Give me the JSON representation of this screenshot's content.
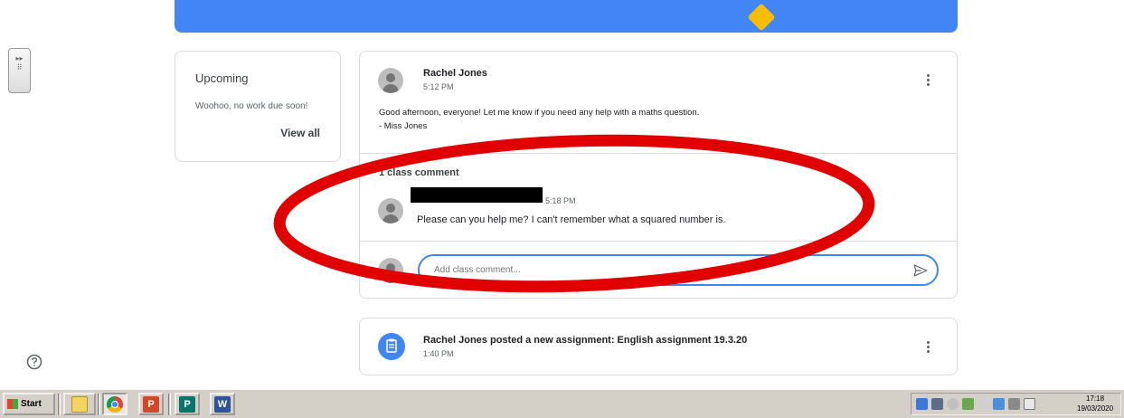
{
  "sidebar": {
    "upcoming_title": "Upcoming",
    "upcoming_text": "Woohoo, no work due soon!",
    "view_all": "View all"
  },
  "post": {
    "author": "Rachel Jones",
    "time": "5:12 PM",
    "body_line1": "Good afternoon, everyone! Let me know if you need any help with a maths question.",
    "body_line2": "- Miss Jones",
    "comment_count": "1 class comment",
    "comment": {
      "time": "5:18 PM",
      "text": "Please can you help me? I can't remember what a squared number is."
    },
    "comment_input_placeholder": "Add class comment..."
  },
  "assignment": {
    "title": "Rachel Jones posted a new assignment: English assignment 19.3.20",
    "time": "1:40 PM"
  },
  "taskbar": {
    "start_label": "Start",
    "clock_time": "17:18",
    "clock_date": "19/03/2020"
  },
  "colors": {
    "accent": "#4285f4",
    "annotation": "#e00000"
  }
}
